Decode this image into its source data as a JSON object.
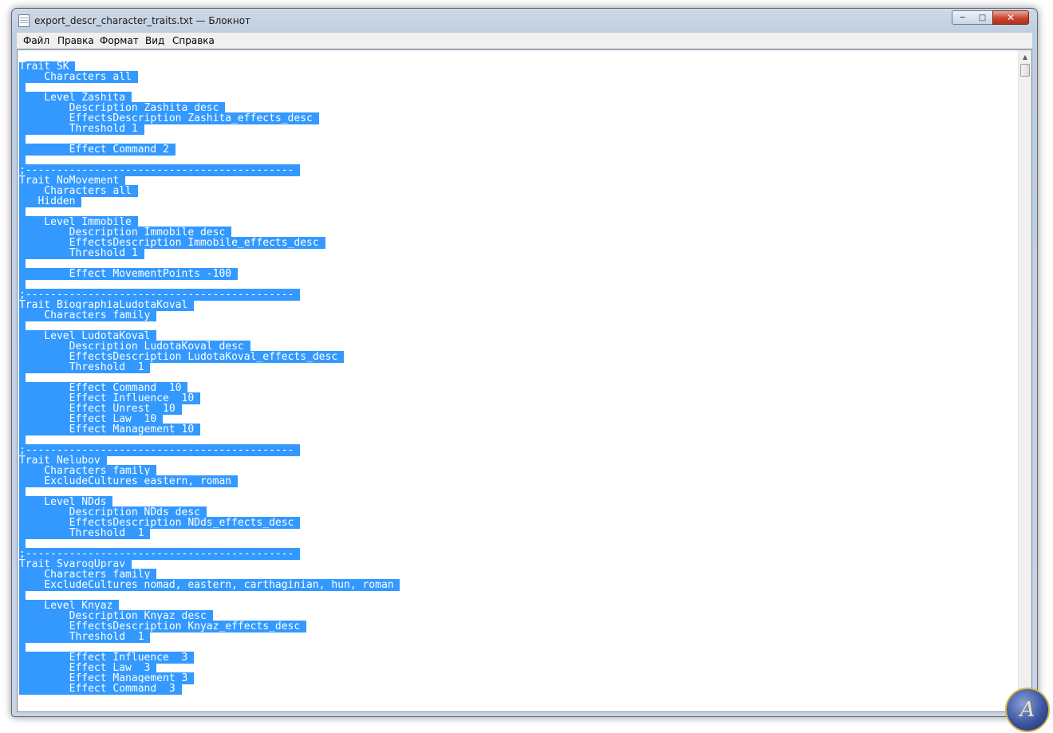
{
  "window": {
    "title": "export_descr_character_traits.txt — Блокнот",
    "controls": {
      "minimize": "─",
      "maximize": "□",
      "close": "✕"
    }
  },
  "menu": {
    "items": [
      "Файл",
      "Правка",
      "Формат",
      "Вид",
      "Справка"
    ]
  },
  "editor": {
    "lines": [
      "Trait SK",
      "    Characters all",
      "",
      "    Level Zashita",
      "        Description Zashita_desc",
      "        EffectsDescription Zashita_effects_desc",
      "        Threshold 1",
      "",
      "        Effect Command 2",
      "",
      ";-------------------------------------------",
      "Trait NoMovement",
      "    Characters all",
      "   Hidden",
      "",
      "    Level Immobile",
      "        Description Immobile_desc",
      "        EffectsDescription Immobile_effects_desc",
      "        Threshold 1",
      "",
      "        Effect MovementPoints -100",
      "",
      ";-------------------------------------------",
      "Trait BiographiaLudotaKoval",
      "    Characters family",
      "",
      "    Level LudotaKoval",
      "        Description LudotaKoval_desc",
      "        EffectsDescription LudotaKoval_effects_desc",
      "        Threshold  1",
      "",
      "        Effect Command  10",
      "        Effect Influence  10",
      "        Effect Unrest  10",
      "        Effect Law  10",
      "        Effect Management 10",
      "",
      ";-------------------------------------------",
      "Trait Nelubov",
      "    Characters family",
      "    ExcludeCultures eastern, roman",
      "",
      "    Level NDds",
      "        Description NDds_desc",
      "        EffectsDescription NDds_effects_desc",
      "        Threshold  1",
      "",
      ";-------------------------------------------",
      "Trait SvarogUprav",
      "    Characters family",
      "    ExcludeCultures nomad, eastern, carthaginian, hun, roman",
      "",
      "    Level Knyaz",
      "        Description Knyaz_desc",
      "        EffectsDescription Knyaz_effects_desc",
      "        Threshold  1",
      "",
      "        Effect Influence  3",
      "        Effect Law  3",
      "        Effect Management 3",
      "        Effect Command  3"
    ]
  },
  "colors": {
    "selection": "#3399ff",
    "selection_text": "#ffffff"
  },
  "badge": {
    "icon": "laurel-emblem-icon",
    "letter": "A"
  }
}
